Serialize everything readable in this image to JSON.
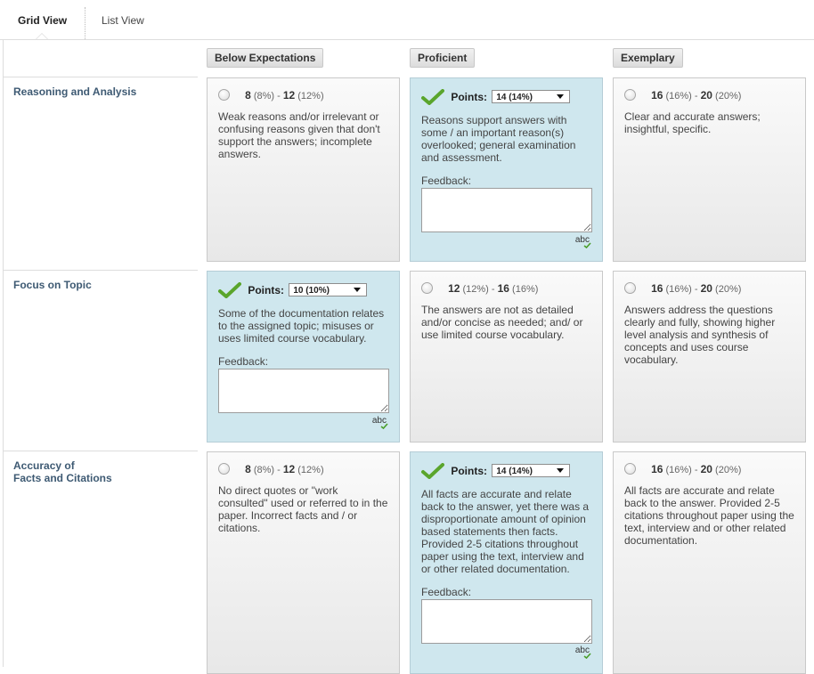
{
  "tabs": {
    "grid": "Grid View",
    "list": "List View"
  },
  "columns": [
    "Below Expectations",
    "Proficient",
    "Exemplary"
  ],
  "criteria": [
    {
      "name_line1": "Reasoning and Analysis",
      "cells": [
        {
          "lo": "8",
          "lo_pct": "(8%)",
          "sep": "-",
          "hi": "12",
          "hi_pct": "(12%)",
          "desc": "Weak reasons and/or irrelevant or confusing reasons given that don't support the answers; incomplete answers."
        },
        {
          "points_label": "Points:",
          "points_value": "14 (14%)",
          "desc": "Reasons support answers with some / an important reason(s) overlooked; general examination and assessment.",
          "feedback_label": "Feedback:",
          "spell": "abc"
        },
        {
          "lo": "16",
          "lo_pct": "(16%)",
          "sep": "-",
          "hi": "20",
          "hi_pct": "(20%)",
          "desc": "Clear and accurate answers; insightful, specific."
        }
      ]
    },
    {
      "name_line1": "Focus on Topic",
      "cells": [
        {
          "points_label": "Points:",
          "points_value": "10 (10%)",
          "desc": "Some of the documentation relates to the assigned topic; misuses or uses limited course vocabulary.",
          "feedback_label": "Feedback:",
          "spell": "abc"
        },
        {
          "lo": "12",
          "lo_pct": "(12%)",
          "sep": "-",
          "hi": "16",
          "hi_pct": "(16%)",
          "desc": "The answers are not as detailed and/or concise as needed; and/ or use limited course vocabulary."
        },
        {
          "lo": "16",
          "lo_pct": "(16%)",
          "sep": "-",
          "hi": "20",
          "hi_pct": "(20%)",
          "desc": "Answers address the questions clearly and fully, showing higher level analysis and synthesis of concepts and uses course vocabulary."
        }
      ]
    },
    {
      "name_line1": "Accuracy of",
      "name_line2": "Facts and Citations",
      "cells": [
        {
          "lo": "8",
          "lo_pct": "(8%)",
          "sep": "-",
          "hi": "12",
          "hi_pct": "(12%)",
          "desc": "No direct quotes or \"work consulted\" used or referred to in the paper. Incorrect facts and / or citations."
        },
        {
          "points_label": "Points:",
          "points_value": "14 (14%)",
          "desc": "All facts are accurate and relate back to the answer, yet there was a disproportionate amount of opinion based statements then facts. Provided 2-5 citations throughout paper using the text, interview and or other related documentation.",
          "feedback_label": "Feedback:",
          "spell": "abc"
        },
        {
          "lo": "16",
          "lo_pct": "(16%)",
          "sep": "-",
          "hi": "20",
          "hi_pct": "(20%)",
          "desc": "All facts are accurate and relate back to the answer. Provided 2-5 citations throughout paper using the text, interview and or other related documentation."
        }
      ]
    }
  ]
}
